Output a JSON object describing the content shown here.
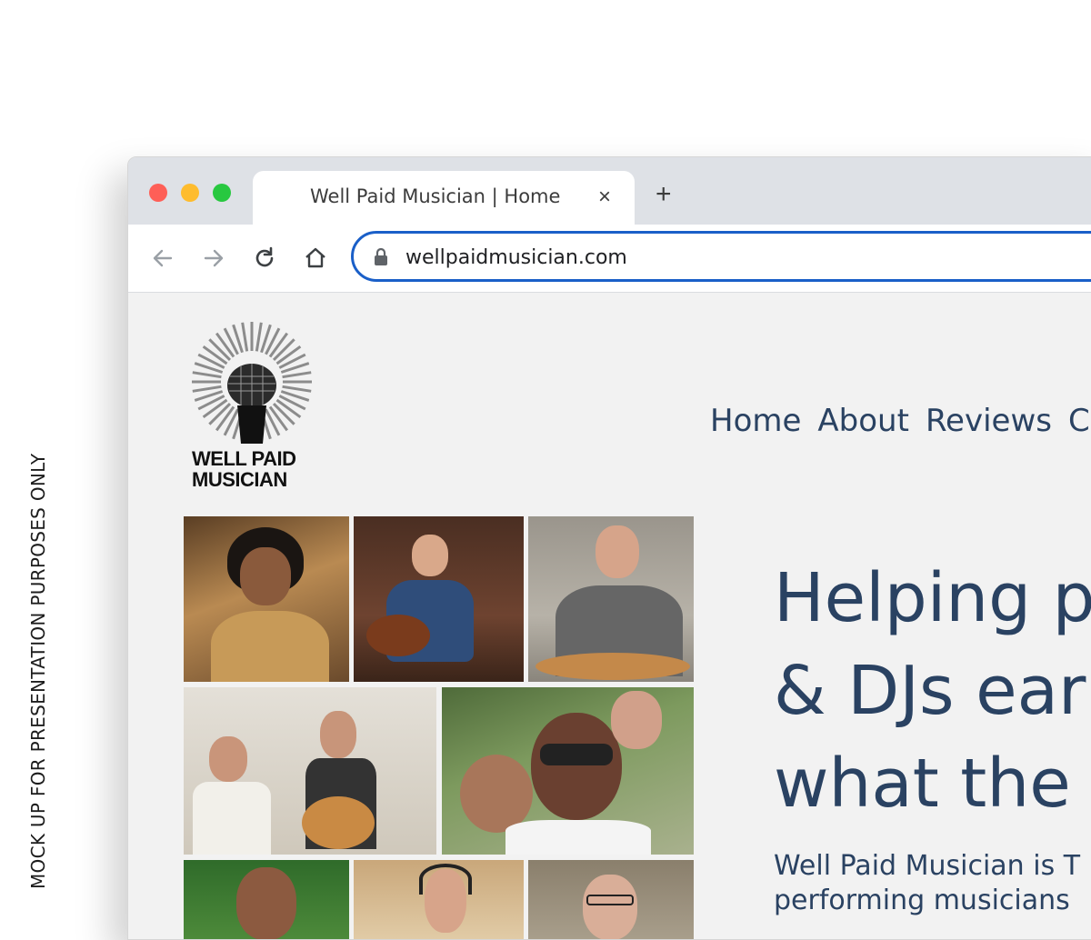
{
  "side_note": "MOCK UP FOR PRESENTATION PURPOSES ONLY",
  "browser": {
    "tab_title": "Well Paid Musician | Home",
    "tab_close": "×",
    "new_tab": "+",
    "url": "wellpaidmusician.com",
    "accent_color": "#1a5fc8",
    "icons": [
      "back-arrow-icon",
      "forward-arrow-icon",
      "reload-icon",
      "home-icon",
      "lock-icon"
    ]
  },
  "site": {
    "logo_line1": "WELL PAID",
    "logo_line2": "MUSICIAN",
    "nav": [
      "Home",
      "About",
      "Reviews",
      "C"
    ],
    "headline": [
      "Helping p",
      "& DJs ear",
      "what the"
    ],
    "subtext": [
      "Well Paid Musician is T",
      "performing musicians"
    ],
    "text_color": "#2a4262",
    "photos": [
      "singer-woman-photo",
      "guitarist-man-photo",
      "man-with-guitar-photo",
      "duo-musicians-photo",
      "selfie-group-photo",
      "woman-outdoors-photo",
      "singer-headphones-photo",
      "man-glasses-photo"
    ]
  }
}
